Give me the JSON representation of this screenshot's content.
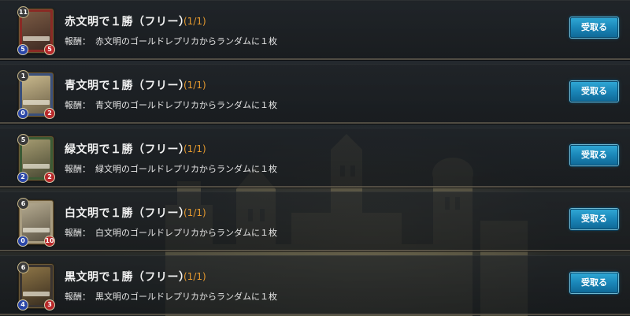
{
  "missions": [
    {
      "title": "赤文明で１勝（フリー）",
      "progress": "(1/1)",
      "reward_label": "報酬：",
      "reward_text": "赤文明のゴールドレプリカからランダムに１枚",
      "button_label": "受取る",
      "card": {
        "cost": "11",
        "attack": "5",
        "hp": "5",
        "frame_color": "#8a2a24",
        "art_color": "#5a3a2c"
      }
    },
    {
      "title": "青文明で１勝（フリー）",
      "progress": "(1/1)",
      "reward_label": "報酬：",
      "reward_text": "青文明のゴールドレプリカからランダムに１枚",
      "button_label": "受取る",
      "card": {
        "cost": "1",
        "attack": "0",
        "hp": "2",
        "frame_color": "#3a4f7a",
        "art_color": "#8f8160"
      }
    },
    {
      "title": "緑文明で１勝（フリー）",
      "progress": "(1/1)",
      "reward_label": "報酬：",
      "reward_text": "緑文明のゴールドレプリカからランダムに１枚",
      "button_label": "受取る",
      "card": {
        "cost": "5",
        "attack": "2",
        "hp": "2",
        "frame_color": "#3b5a34",
        "art_color": "#6d6a4c"
      }
    },
    {
      "title": "白文明で１勝（フリー）",
      "progress": "(1/1)",
      "reward_label": "報酬：",
      "reward_text": "白文明のゴールドレプリカからランダムに１枚",
      "button_label": "受取る",
      "card": {
        "cost": "6",
        "attack": "0",
        "hp": "10",
        "frame_color": "#a89c80",
        "art_color": "#7c7460"
      }
    },
    {
      "title": "黒文明で１勝（フリー）",
      "progress": "(1/1)",
      "reward_label": "報酬：",
      "reward_text": "黒文明のゴールドレプリカからランダムに１枚",
      "button_label": "受取る",
      "card": {
        "cost": "6",
        "attack": "4",
        "hp": "3",
        "frame_color": "#3a3430",
        "art_color": "#6b5a3a"
      }
    }
  ],
  "accent_colors": {
    "progress": "#e69a2e",
    "button": "#1a86b8"
  }
}
